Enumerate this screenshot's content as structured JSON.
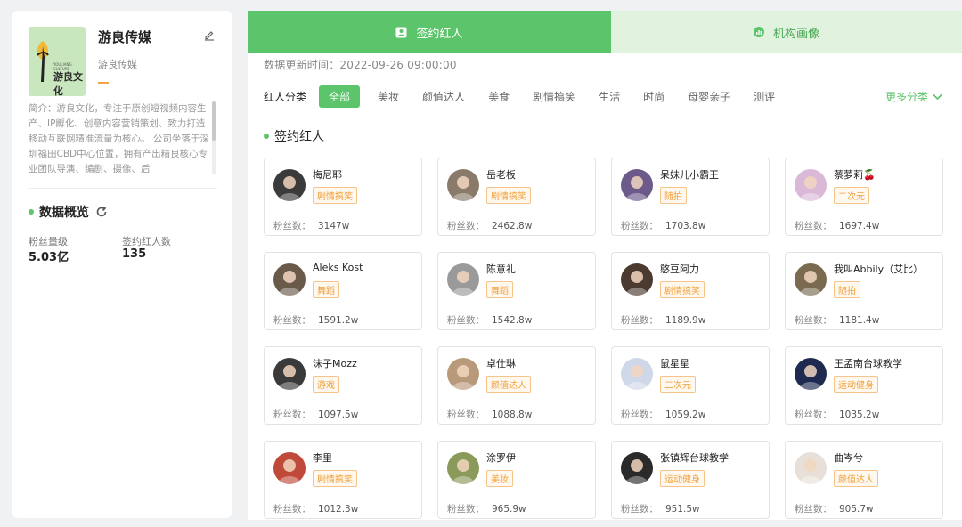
{
  "company": {
    "name": "游良传媒",
    "subname": "游良传媒",
    "logo_text": "游良文化",
    "logo_small_text": "YOULIANG CULTURE",
    "intro": "简介：游良文化，专注于原创短视频内容生产、IP孵化、创意内容营销策划、致力打造移动互联网精准流量为核心。 公司坐落于深圳福田CBD中心位置，拥有产出精良核心专业团队导演、编剧、摄像、后"
  },
  "overview": {
    "title": "数据概览",
    "stats": [
      {
        "label": "粉丝量级",
        "value": "5.03亿"
      },
      {
        "label": "签约红人数",
        "value": "135"
      }
    ]
  },
  "tabs": [
    {
      "label": "签约红人",
      "icon": "person-card-icon",
      "active": true
    },
    {
      "label": "机构画像",
      "icon": "chart-circle-icon",
      "active": false
    }
  ],
  "update_time": "数据更新时间：2022-09-26 09:00:00",
  "filter": {
    "label": "红人分类",
    "categories": [
      "全部",
      "美妆",
      "颜值达人",
      "美食",
      "剧情搞笑",
      "生活",
      "时尚",
      "母婴亲子",
      "测评"
    ],
    "active_index": 0,
    "more_label": "更多分类"
  },
  "section_title": "签约红人",
  "fans_label": "粉丝数：",
  "colors": {
    "accent": "#5cc46a",
    "tag": "#f0a03c",
    "tab_inactive_bg": "#e1f3de"
  },
  "influencers": [
    {
      "name": "梅尼耶",
      "tag": "剧情搞笑",
      "fans": "3147w",
      "avatar": "#3b3b3b"
    },
    {
      "name": "岳老板",
      "tag": "剧情搞笑",
      "fans": "2462.8w",
      "avatar": "#8a7a6a"
    },
    {
      "name": "呆妹儿小霸王",
      "tag": "随拍",
      "fans": "1703.8w",
      "avatar": "#6b5a8a"
    },
    {
      "name": "蔡萝莉🍒",
      "tag": "二次元",
      "fans": "1697.4w",
      "avatar": "#d9b8d8"
    },
    {
      "name": "Aleks Kost",
      "tag": "舞蹈",
      "fans": "1591.2w",
      "avatar": "#6a5a4a"
    },
    {
      "name": "陈意礼",
      "tag": "舞蹈",
      "fans": "1542.8w",
      "avatar": "#9a9a9a"
    },
    {
      "name": "憨豆阿力",
      "tag": "剧情搞笑",
      "fans": "1189.9w",
      "avatar": "#4a3a30"
    },
    {
      "name": "我叫Abbily（艾比）",
      "tag": "随拍",
      "fans": "1181.4w",
      "avatar": "#7a6a50"
    },
    {
      "name": "沫子Mozz",
      "tag": "游戏",
      "fans": "1097.5w",
      "avatar": "#3a3a3a"
    },
    {
      "name": "卓仕琳",
      "tag": "颜值达人",
      "fans": "1088.8w",
      "avatar": "#b89a7a"
    },
    {
      "name": "鼠星星",
      "tag": "二次元",
      "fans": "1059.2w",
      "avatar": "#cfd8e8"
    },
    {
      "name": "王孟南台球教学",
      "tag": "运动健身",
      "fans": "1035.2w",
      "avatar": "#1e2a50"
    },
    {
      "name": "李里",
      "tag": "剧情搞笑",
      "fans": "1012.3w",
      "avatar": "#c04a3a"
    },
    {
      "name": "涂罗伊",
      "tag": "美妆",
      "fans": "965.9w",
      "avatar": "#8a9a5a"
    },
    {
      "name": "张镇辉台球教学",
      "tag": "运动健身",
      "fans": "951.5w",
      "avatar": "#2a2a2a"
    },
    {
      "name": "曲岑兮",
      "tag": "颜值达人",
      "fans": "905.7w",
      "avatar": "#e8e0d8"
    }
  ]
}
